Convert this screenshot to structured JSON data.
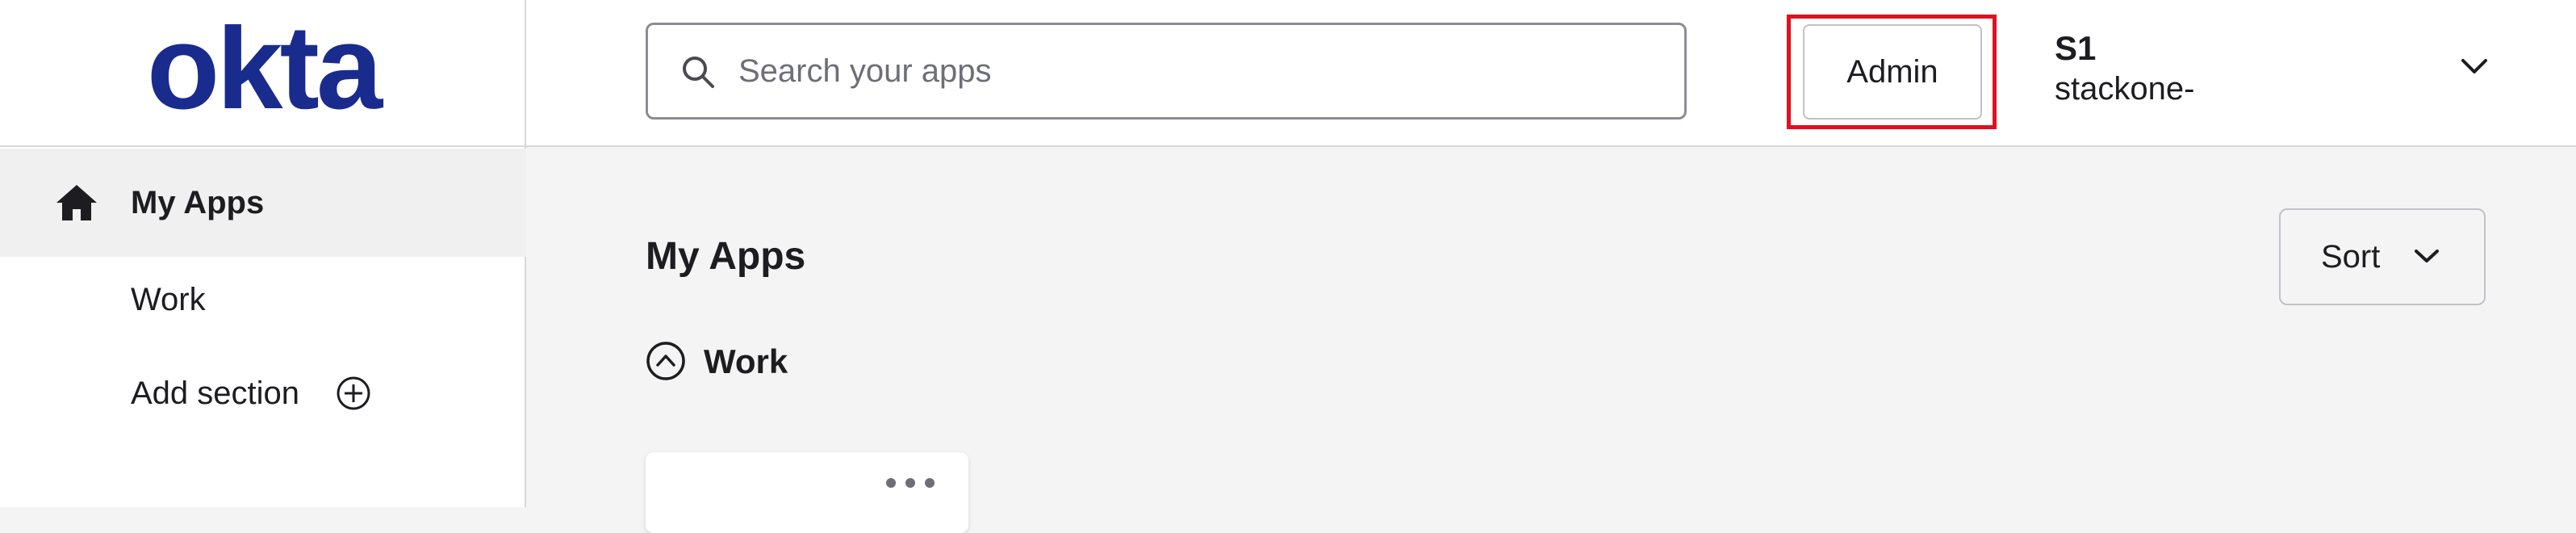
{
  "brand": {
    "logo_text": "okta",
    "logo_color": "#1a2b8e"
  },
  "sidebar": {
    "items": [
      {
        "label": "My Apps",
        "icon": "home-icon",
        "active": true
      },
      {
        "label": "Work"
      },
      {
        "label": "Add section",
        "icon": "plus-circle-icon"
      }
    ]
  },
  "header": {
    "search": {
      "placeholder": "Search your apps",
      "icon": "search-icon"
    },
    "admin_label": "Admin",
    "highlight_color": "#e0101e",
    "user": {
      "initials": "S1",
      "org": "stackone-"
    }
  },
  "main": {
    "title": "My Apps",
    "sort_label": "Sort",
    "section": {
      "label": "Work",
      "expanded": true
    }
  }
}
